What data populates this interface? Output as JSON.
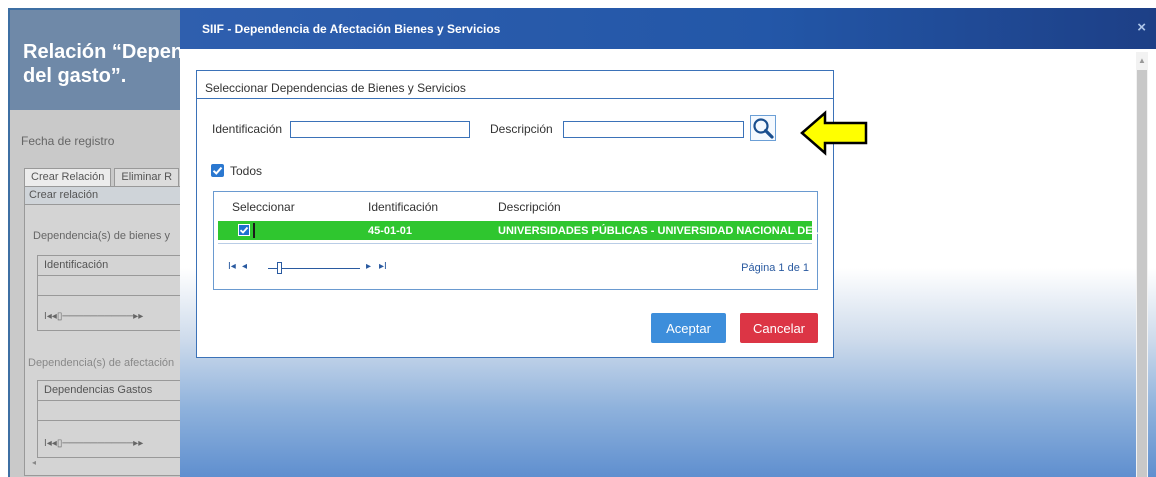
{
  "background": {
    "title": "Relación “Depen\ndel gasto”.",
    "fecha_label": "Fecha de registro",
    "tabs": [
      "Crear Relación",
      "Eliminar R"
    ],
    "panel_title": "Crear relación",
    "section1_label": "Dependencia(s) de bienes y",
    "grid1_header": "Identificación",
    "section2_label": "Dependencia(s) de afectación",
    "grid2_header": "Dependencias Gastos"
  },
  "modal": {
    "title": "SIIF - Dependencia de Afectación Bienes y Servicios",
    "close_icon": "close-icon"
  },
  "dialog": {
    "heading": "Seleccionar Dependencias de Bienes y Servicios",
    "identificacion_label": "Identificación",
    "identificacion_value": "",
    "descripcion_label": "Descripción",
    "descripcion_value": "",
    "search_icon": "magnifier-icon",
    "todos_label": "Todos",
    "todos_checked": true,
    "grid": {
      "columns": [
        "Seleccionar",
        "Identificación",
        "Descripción"
      ],
      "rows": [
        {
          "selected": true,
          "identificacion": "45-01-01",
          "descripcion": "UNIVERSIDADES PÚBLICAS - UNIVERSIDAD NACIONAL DE..."
        }
      ],
      "page_info": "Página 1 de 1"
    },
    "accept_label": "Aceptar",
    "cancel_label": "Cancelar"
  },
  "colors": {
    "titlebar": "#2357a8",
    "selected_row": "#2fc62f",
    "accept": "#3d8edb",
    "cancel": "#dc3545",
    "arrow": "#ffff00"
  }
}
